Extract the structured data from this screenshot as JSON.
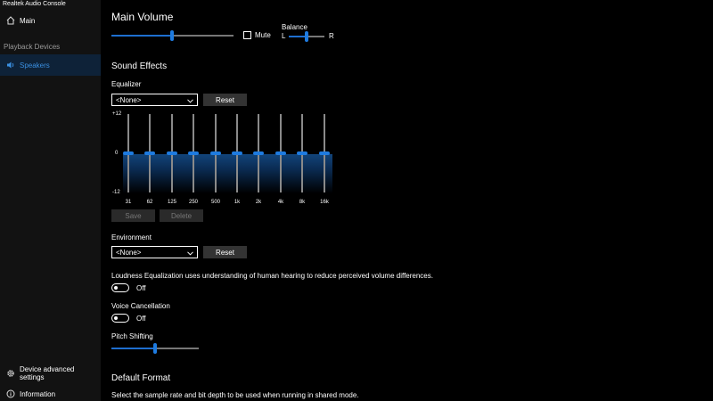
{
  "window": {
    "title": "Realtek Audio Console"
  },
  "sidebar": {
    "main_label": "Main",
    "section_label": "Playback Devices",
    "active_item": "Speakers",
    "device_advanced_settings": "Device advanced settings",
    "information": "Information",
    "icons": {
      "main": "home-icon",
      "speakers": "speaker-icon",
      "settings": "gear-icon",
      "info": "info-icon"
    }
  },
  "main_volume": {
    "title": "Main Volume",
    "level": 0.5,
    "mute_label": "Mute",
    "mute_checked": false,
    "balance_label": "Balance",
    "balance_left": "L",
    "balance_right": "R",
    "balance_level": 0.5
  },
  "sound_effects": {
    "title": "Sound Effects",
    "equalizer_label": "Equalizer",
    "equalizer_value": "<None>",
    "reset_label": "Reset",
    "axis_top": "+12",
    "axis_mid": "0",
    "axis_bottom": "-12",
    "bands": [
      "31",
      "62",
      "125",
      "250",
      "500",
      "1k",
      "2k",
      "4k",
      "8k",
      "16k"
    ],
    "band_values_db": [
      0,
      0,
      0,
      0,
      0,
      0,
      0,
      0,
      0,
      0
    ],
    "save_label": "Save",
    "delete_label": "Delete",
    "environment_label": "Environment",
    "environment_value": "<None>",
    "env_reset_label": "Reset",
    "loudness_desc": "Loudness Equalization uses understanding of human hearing to reduce perceived volume differences.",
    "loudness_state": "Off",
    "voice_cancel_label": "Voice Cancellation",
    "voice_cancel_state": "Off",
    "pitch_label": "Pitch Shifting",
    "pitch_level": 0.5
  },
  "default_format": {
    "title": "Default Format",
    "desc": "Select the sample rate and bit depth to be used when running in shared mode."
  },
  "colors": {
    "accent": "#1e7be0",
    "active_bg": "#0e2238",
    "active_text": "#3a8fe0"
  }
}
